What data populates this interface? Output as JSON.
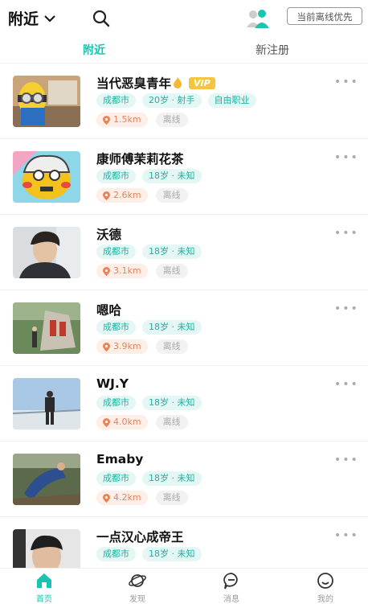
{
  "header": {
    "location_label": "附近",
    "offline_first_label": "当前离线优先"
  },
  "tabs": [
    {
      "label": "附近",
      "active": true
    },
    {
      "label": "新注册",
      "active": false
    }
  ],
  "users": [
    {
      "name": "当代恶臭青年",
      "vip_label": "VIP",
      "tags": [
        "成都市",
        "20岁 · 射手",
        "自由职业"
      ],
      "distance": "1.5km",
      "status": "离线"
    },
    {
      "name": "康师傅茉莉花茶",
      "tags": [
        "成都市",
        "18岁 · 未知"
      ],
      "distance": "2.6km",
      "status": "离线"
    },
    {
      "name": "沃德",
      "tags": [
        "成都市",
        "18岁 · 未知"
      ],
      "distance": "3.1km",
      "status": "离线"
    },
    {
      "name": "嗯哈",
      "tags": [
        "成都市",
        "18岁 · 未知"
      ],
      "distance": "3.9km",
      "status": "离线"
    },
    {
      "name": "WJ.Y",
      "tags": [
        "成都市",
        "18岁 · 未知"
      ],
      "distance": "4.0km",
      "status": "离线"
    },
    {
      "name": "Emaby",
      "tags": [
        "成都市",
        "18岁 · 未知"
      ],
      "distance": "4.2km",
      "status": "离线"
    },
    {
      "name": "一点汉心成帝王",
      "tags": [
        "成都市",
        "18岁 · 未知"
      ],
      "distance": "",
      "status": ""
    }
  ],
  "more_label": "•••",
  "bottom_nav": [
    {
      "label": "首页",
      "icon": "home-icon",
      "active": true
    },
    {
      "label": "发现",
      "icon": "planet-icon",
      "active": false
    },
    {
      "label": "消息",
      "icon": "message-icon",
      "active": false
    },
    {
      "label": "我的",
      "icon": "profile-icon",
      "active": false
    }
  ],
  "colors": {
    "accent": "#19c4b0",
    "distance": "#e8825a",
    "vip": "#f5c542"
  }
}
